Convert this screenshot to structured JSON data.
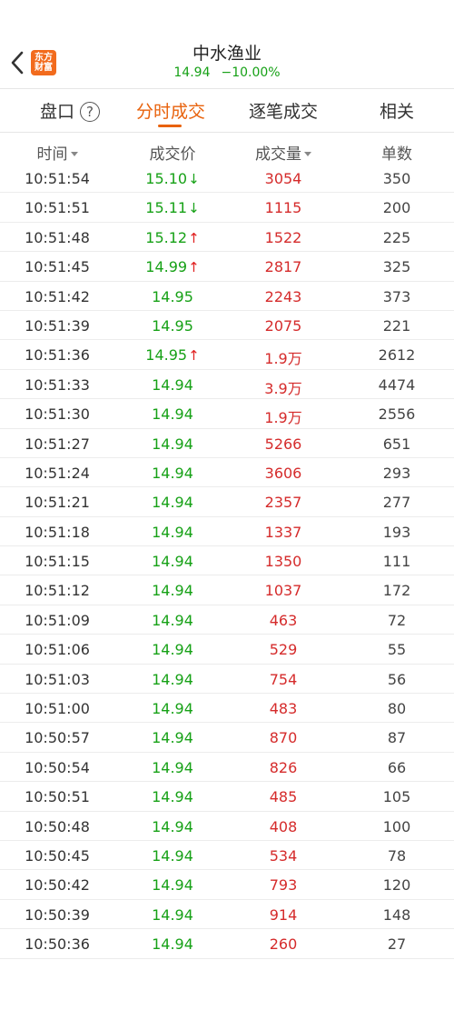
{
  "header": {
    "back_icon": "chevron-left-icon",
    "logo_line1": "东方",
    "logo_line2": "财富",
    "logo_color": "#f26b1d",
    "title": "中水渔业",
    "price": "14.94",
    "change_pct": "−10.00%"
  },
  "tabs": [
    {
      "label": "盘口",
      "active": false
    },
    {
      "label": "分时成交",
      "active": true
    },
    {
      "label": "逐笔成交",
      "active": false
    },
    {
      "label": "相关",
      "active": false
    }
  ],
  "help_icon": "?",
  "columns": [
    "时间",
    "成交价",
    "成交量",
    "单数"
  ],
  "colors": {
    "accent": "#e8620c",
    "down": "#16a116",
    "up": "#d52b2b"
  },
  "rows": [
    {
      "time": "10:51:54",
      "price": "15.10",
      "dir": "down",
      "volume": "3054",
      "count": "350"
    },
    {
      "time": "10:51:51",
      "price": "15.11",
      "dir": "down",
      "volume": "1115",
      "count": "200"
    },
    {
      "time": "10:51:48",
      "price": "15.12",
      "dir": "up",
      "volume": "1522",
      "count": "225"
    },
    {
      "time": "10:51:45",
      "price": "14.99",
      "dir": "up",
      "volume": "2817",
      "count": "325"
    },
    {
      "time": "10:51:42",
      "price": "14.95",
      "dir": "",
      "volume": "2243",
      "count": "373"
    },
    {
      "time": "10:51:39",
      "price": "14.95",
      "dir": "",
      "volume": "2075",
      "count": "221"
    },
    {
      "time": "10:51:36",
      "price": "14.95",
      "dir": "up",
      "volume": "1.9万",
      "count": "2612"
    },
    {
      "time": "10:51:33",
      "price": "14.94",
      "dir": "",
      "volume": "3.9万",
      "count": "4474"
    },
    {
      "time": "10:51:30",
      "price": "14.94",
      "dir": "",
      "volume": "1.9万",
      "count": "2556"
    },
    {
      "time": "10:51:27",
      "price": "14.94",
      "dir": "",
      "volume": "5266",
      "count": "651"
    },
    {
      "time": "10:51:24",
      "price": "14.94",
      "dir": "",
      "volume": "3606",
      "count": "293"
    },
    {
      "time": "10:51:21",
      "price": "14.94",
      "dir": "",
      "volume": "2357",
      "count": "277"
    },
    {
      "time": "10:51:18",
      "price": "14.94",
      "dir": "",
      "volume": "1337",
      "count": "193"
    },
    {
      "time": "10:51:15",
      "price": "14.94",
      "dir": "",
      "volume": "1350",
      "count": "111"
    },
    {
      "time": "10:51:12",
      "price": "14.94",
      "dir": "",
      "volume": "1037",
      "count": "172"
    },
    {
      "time": "10:51:09",
      "price": "14.94",
      "dir": "",
      "volume": "463",
      "count": "72"
    },
    {
      "time": "10:51:06",
      "price": "14.94",
      "dir": "",
      "volume": "529",
      "count": "55"
    },
    {
      "time": "10:51:03",
      "price": "14.94",
      "dir": "",
      "volume": "754",
      "count": "56"
    },
    {
      "time": "10:51:00",
      "price": "14.94",
      "dir": "",
      "volume": "483",
      "count": "80"
    },
    {
      "time": "10:50:57",
      "price": "14.94",
      "dir": "",
      "volume": "870",
      "count": "87"
    },
    {
      "time": "10:50:54",
      "price": "14.94",
      "dir": "",
      "volume": "826",
      "count": "66"
    },
    {
      "time": "10:50:51",
      "price": "14.94",
      "dir": "",
      "volume": "485",
      "count": "105"
    },
    {
      "time": "10:50:48",
      "price": "14.94",
      "dir": "",
      "volume": "408",
      "count": "100"
    },
    {
      "time": "10:50:45",
      "price": "14.94",
      "dir": "",
      "volume": "534",
      "count": "78"
    },
    {
      "time": "10:50:42",
      "price": "14.94",
      "dir": "",
      "volume": "793",
      "count": "120"
    },
    {
      "time": "10:50:39",
      "price": "14.94",
      "dir": "",
      "volume": "914",
      "count": "148"
    },
    {
      "time": "10:50:36",
      "price": "14.94",
      "dir": "",
      "volume": "260",
      "count": "27"
    }
  ]
}
